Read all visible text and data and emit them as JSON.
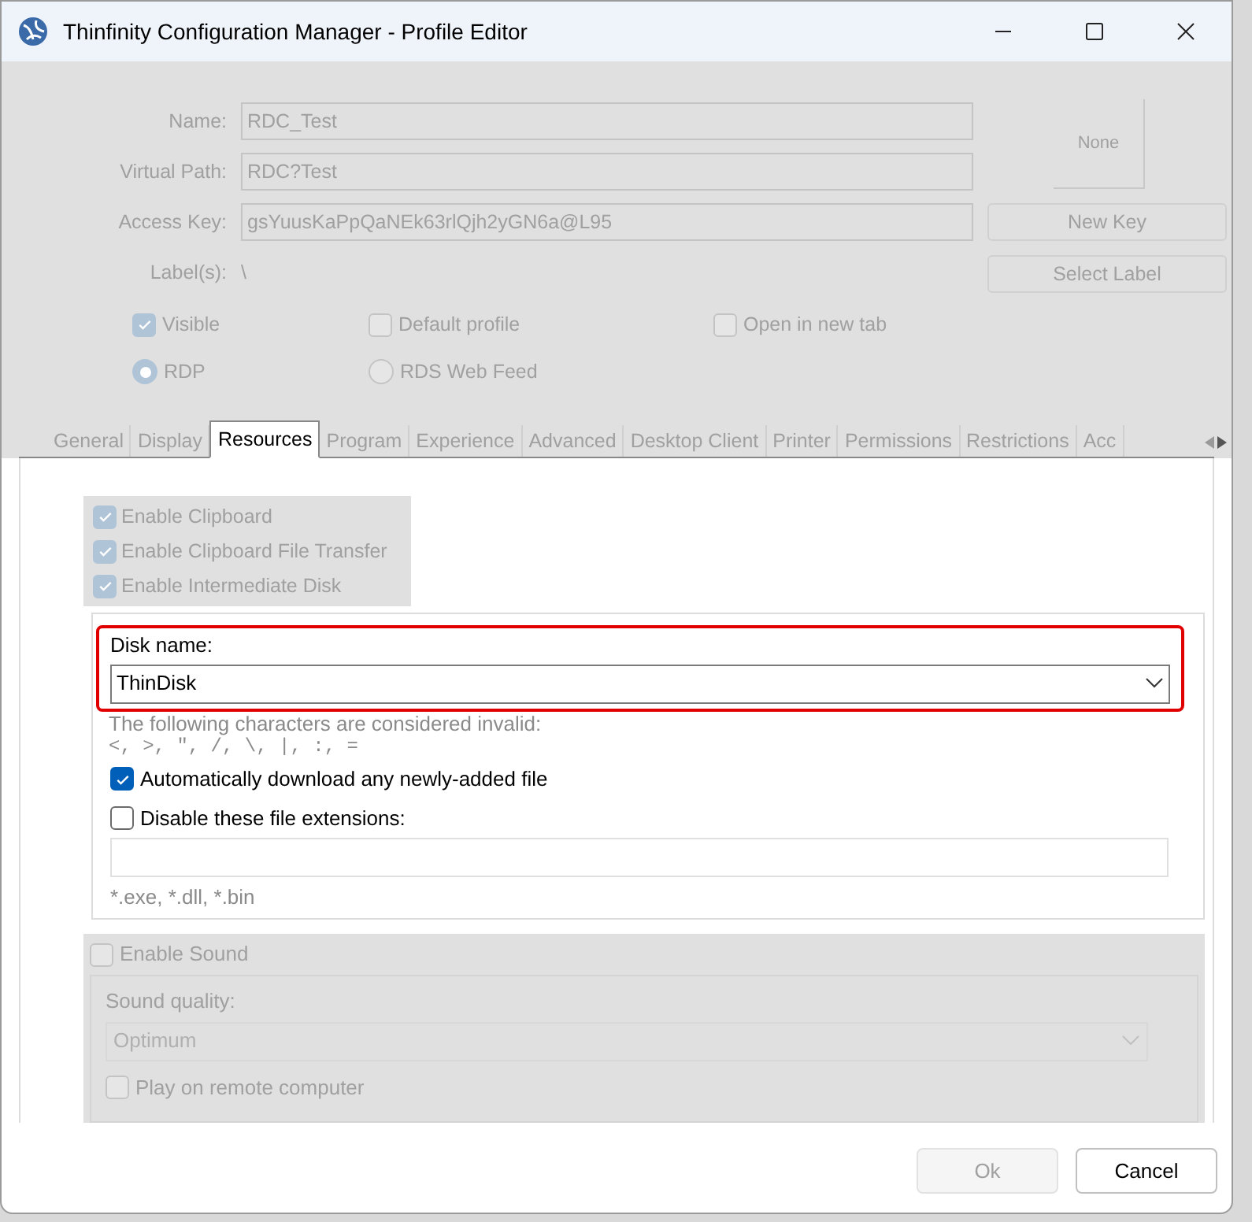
{
  "window": {
    "title": "Thinfinity Configuration Manager - Profile Editor"
  },
  "profile": {
    "disabled": true,
    "fields": [
      {
        "label": "Name:",
        "value": "RDC_Test",
        "kind": "input"
      },
      {
        "label": "Virtual Path:",
        "value": "RDC?Test",
        "kind": "input"
      },
      {
        "label": "Access Key:",
        "value": "gsYuusKaPpQaNEk63rlQjh2yGN6a@L95",
        "kind": "input"
      },
      {
        "label": "Label(s):",
        "value": "\\",
        "kind": "text"
      }
    ],
    "image_button": "None",
    "buttons": [
      "New Key",
      "Select Label"
    ],
    "checkboxes": [
      {
        "label": "Visible",
        "checked": true
      },
      {
        "label": "Default profile",
        "checked": false
      },
      {
        "label": "Open in new tab",
        "checked": false
      }
    ],
    "radios": [
      {
        "label": "RDP",
        "selected": true
      },
      {
        "label": "RDS Web Feed",
        "selected": false
      }
    ]
  },
  "tabs": [
    {
      "label": "General",
      "selected": false
    },
    {
      "label": "Display",
      "selected": false
    },
    {
      "label": "Resources",
      "selected": true
    },
    {
      "label": "Program",
      "selected": false
    },
    {
      "label": "Experience",
      "selected": false
    },
    {
      "label": "Advanced",
      "selected": false
    },
    {
      "label": "Desktop Client",
      "selected": false
    },
    {
      "label": "Printer",
      "selected": false
    },
    {
      "label": "Permissions",
      "selected": false
    },
    {
      "label": "Restrictions",
      "selected": false
    },
    {
      "label": "Acc",
      "selected": false
    }
  ],
  "clipboard": {
    "disabled": true,
    "options": [
      {
        "label": "Enable Clipboard",
        "checked": true
      },
      {
        "label": "Enable Clipboard File Transfer",
        "checked": true
      },
      {
        "label": "Enable Intermediate Disk",
        "checked": true
      }
    ]
  },
  "disk": {
    "label": "Disk name:",
    "value": "ThinDisk",
    "highlighted": true,
    "hint": "The following characters are considered invalid:",
    "invalid_chars": "<, >, \", /, \\, |, :, =",
    "options": [
      {
        "label": "Automatically download any newly-added file",
        "checked": true
      },
      {
        "label": "Disable these file extensions:",
        "checked": false
      }
    ],
    "extensions_example": "*.exe, *.dll, *.bin"
  },
  "sound": {
    "disabled": true,
    "label": "Enable Sound",
    "checked": false,
    "quality_label": "Sound quality:",
    "quality": "Optimum",
    "play_label": "Play on remote computer",
    "play_checked": false
  },
  "buttons": [
    {
      "label": "Ok",
      "disabled": true
    },
    {
      "label": "Cancel",
      "disabled": false
    }
  ]
}
